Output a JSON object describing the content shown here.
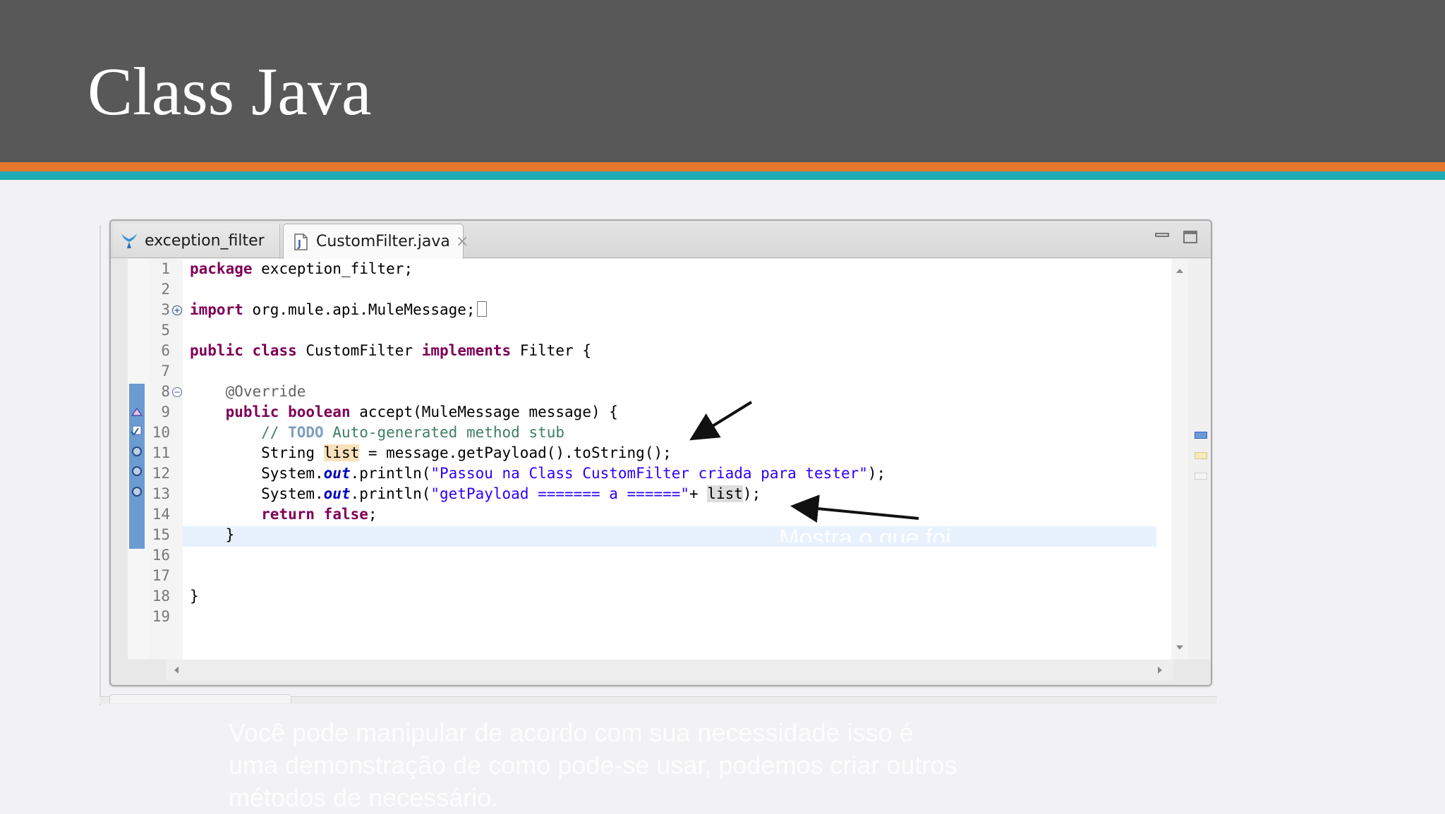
{
  "slide": {
    "title": "Class Java"
  },
  "editor": {
    "tabs": [
      {
        "label": "exception_filter",
        "icon": "mule-project-icon"
      },
      {
        "label": "CustomFilter.java",
        "icon": "java-file-icon",
        "close": "×"
      }
    ],
    "lines": [
      {
        "n": "1"
      },
      {
        "n": "2"
      },
      {
        "n": "3"
      },
      {
        "n": "5"
      },
      {
        "n": "6"
      },
      {
        "n": "7"
      },
      {
        "n": "8"
      },
      {
        "n": "9"
      },
      {
        "n": "10"
      },
      {
        "n": "11"
      },
      {
        "n": "12"
      },
      {
        "n": "13"
      },
      {
        "n": "14"
      },
      {
        "n": "15"
      },
      {
        "n": "16"
      },
      {
        "n": "17"
      },
      {
        "n": "18"
      },
      {
        "n": "19"
      }
    ],
    "code": {
      "l1_kw": "package",
      "l1_rest": " exception_filter;",
      "l3_kw": "import",
      "l3_rest": " org.mule.api.MuleMessage;",
      "l6_kw1": "public",
      "l6_kw2": "class",
      "l6_name": " CustomFilter ",
      "l6_kw3": "implements",
      "l6_rest": " Filter {",
      "l8_ann": "    @Override",
      "l9_kw1": "public",
      "l9_kw2": "boolean",
      "l9_rest": " accept(MuleMessage message) {",
      "l10_cm1": "        // ",
      "l10_tag": "TODO",
      "l10_cm2": " Auto-generated method stub",
      "l11_a": "        String ",
      "l11_var": "list",
      "l11_b": " = message.getPayload().toString();",
      "l12_a": "        System.",
      "l12_fld": "out",
      "l12_b": ".println(",
      "l12_str": "\"Passou na Class CustomFilter criada para tester\"",
      "l12_c": ");",
      "l13_a": "        System.",
      "l13_fld": "out",
      "l13_b": ".println(",
      "l13_str": "\"getPayload ======= a ======\"",
      "l13_c": "+ ",
      "l13_var": "list",
      "l13_d": ");",
      "l14_kw": "return",
      "l14_kw2": "false",
      "l14_rest": ";",
      "l15": "    }",
      "l18": "}"
    }
  },
  "annotations": {
    "note": "Mostra o que foi",
    "caption_lines": [
      "Você pode manipular de acordo com sua necessidade isso  é",
      "uma demonstração de como pode-se usar, podemos  criar outros",
      "métodos de necessário."
    ]
  }
}
